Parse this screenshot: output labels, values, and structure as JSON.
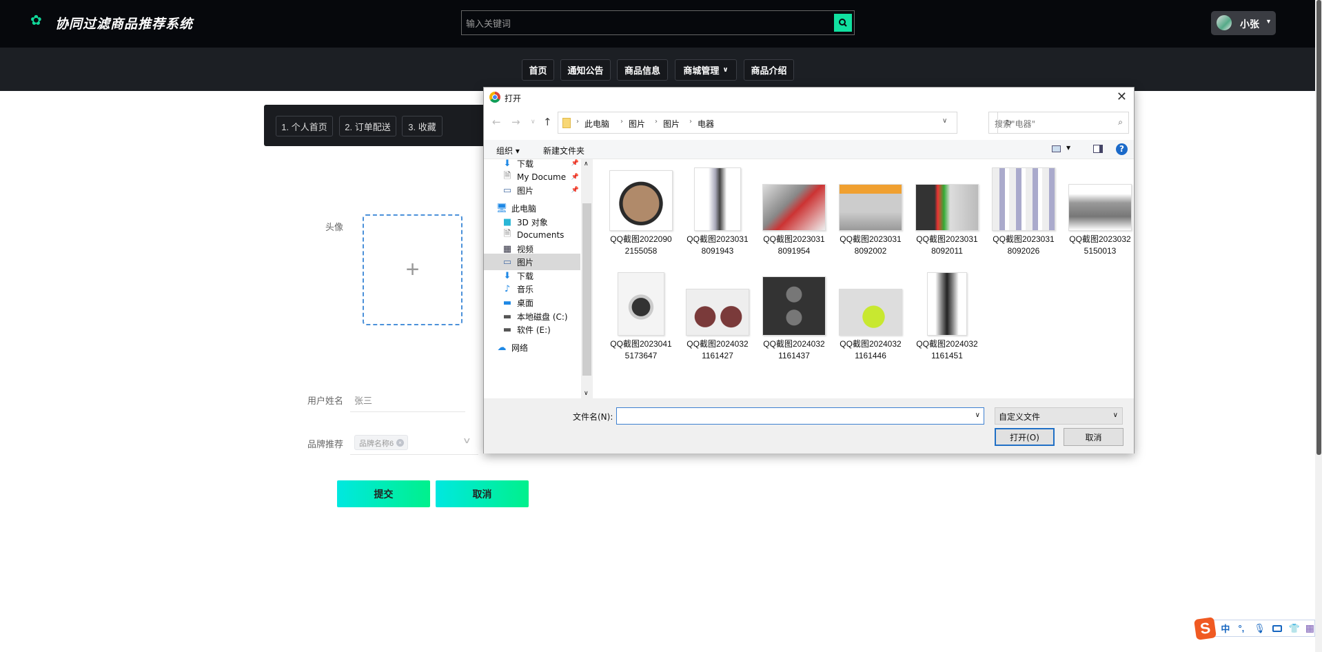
{
  "header": {
    "title": "协同过滤商品推荐系统",
    "search_placeholder": "输入关键词",
    "user": "小张"
  },
  "nav": [
    {
      "label": "首页"
    },
    {
      "label": "通知公告"
    },
    {
      "label": "商品信息"
    },
    {
      "label": "商城管理"
    },
    {
      "label": "商品介绍"
    }
  ],
  "tabs": [
    {
      "label": "1. 个人首页"
    },
    {
      "label": "2. 订单配送"
    },
    {
      "label": "3. 收藏"
    }
  ],
  "form": {
    "avatar_label": "头像",
    "name_label": "用户姓名",
    "name_value": "张三",
    "brand_label": "品牌推荐",
    "brand_tag": "品牌名称6",
    "submit": "提交",
    "cancel": "取消"
  },
  "dialog": {
    "title": "打开",
    "breadcrumb": [
      "此电脑",
      "图片",
      "图片",
      "电器"
    ],
    "search_placeholder": "搜索\"电器\"",
    "organize": "组织 ▾",
    "new_folder": "新建文件夹",
    "sidebar": [
      {
        "label": "下载",
        "icon": "download"
      },
      {
        "label": "My Docume",
        "icon": "document"
      },
      {
        "label": "图片",
        "icon": "pictures"
      },
      {
        "label": "此电脑",
        "icon": "computer"
      },
      {
        "label": "3D 对象",
        "icon": "cube"
      },
      {
        "label": "Documents",
        "icon": "document"
      },
      {
        "label": "视频",
        "icon": "video"
      },
      {
        "label": "图片",
        "icon": "pictures"
      },
      {
        "label": "下载",
        "icon": "download"
      },
      {
        "label": "音乐",
        "icon": "music"
      },
      {
        "label": "桌面",
        "icon": "desktop"
      },
      {
        "label": "本地磁盘 (C:)",
        "icon": "disk"
      },
      {
        "label": "软件 (E:)",
        "icon": "drive"
      },
      {
        "label": "网络",
        "icon": "network"
      }
    ],
    "files": [
      {
        "name": "QQ截图20220902155058"
      },
      {
        "name": "QQ截图20230318091943"
      },
      {
        "name": "QQ截图20230318091954"
      },
      {
        "name": "QQ截图20230318092002"
      },
      {
        "name": "QQ截图20230318092011"
      },
      {
        "name": "QQ截图20230318092026"
      },
      {
        "name": "QQ截图20230325150013"
      },
      {
        "name": "QQ截图20230415173647"
      },
      {
        "name": "QQ截图20240321161427"
      },
      {
        "name": "QQ截图20240321161437"
      },
      {
        "name": "QQ截图20240321161446"
      },
      {
        "name": "QQ截图20240321161451"
      }
    ],
    "filename_label": "文件名(N):",
    "filename_value": "",
    "filetype": "自定义文件",
    "open": "打开(O)",
    "cancel": "取消"
  },
  "ime": {
    "lang": "中",
    "punct": "°,"
  },
  "colors": {
    "accent": "#11e0a0",
    "header": "#06080c",
    "nav": "#1c1f24"
  }
}
